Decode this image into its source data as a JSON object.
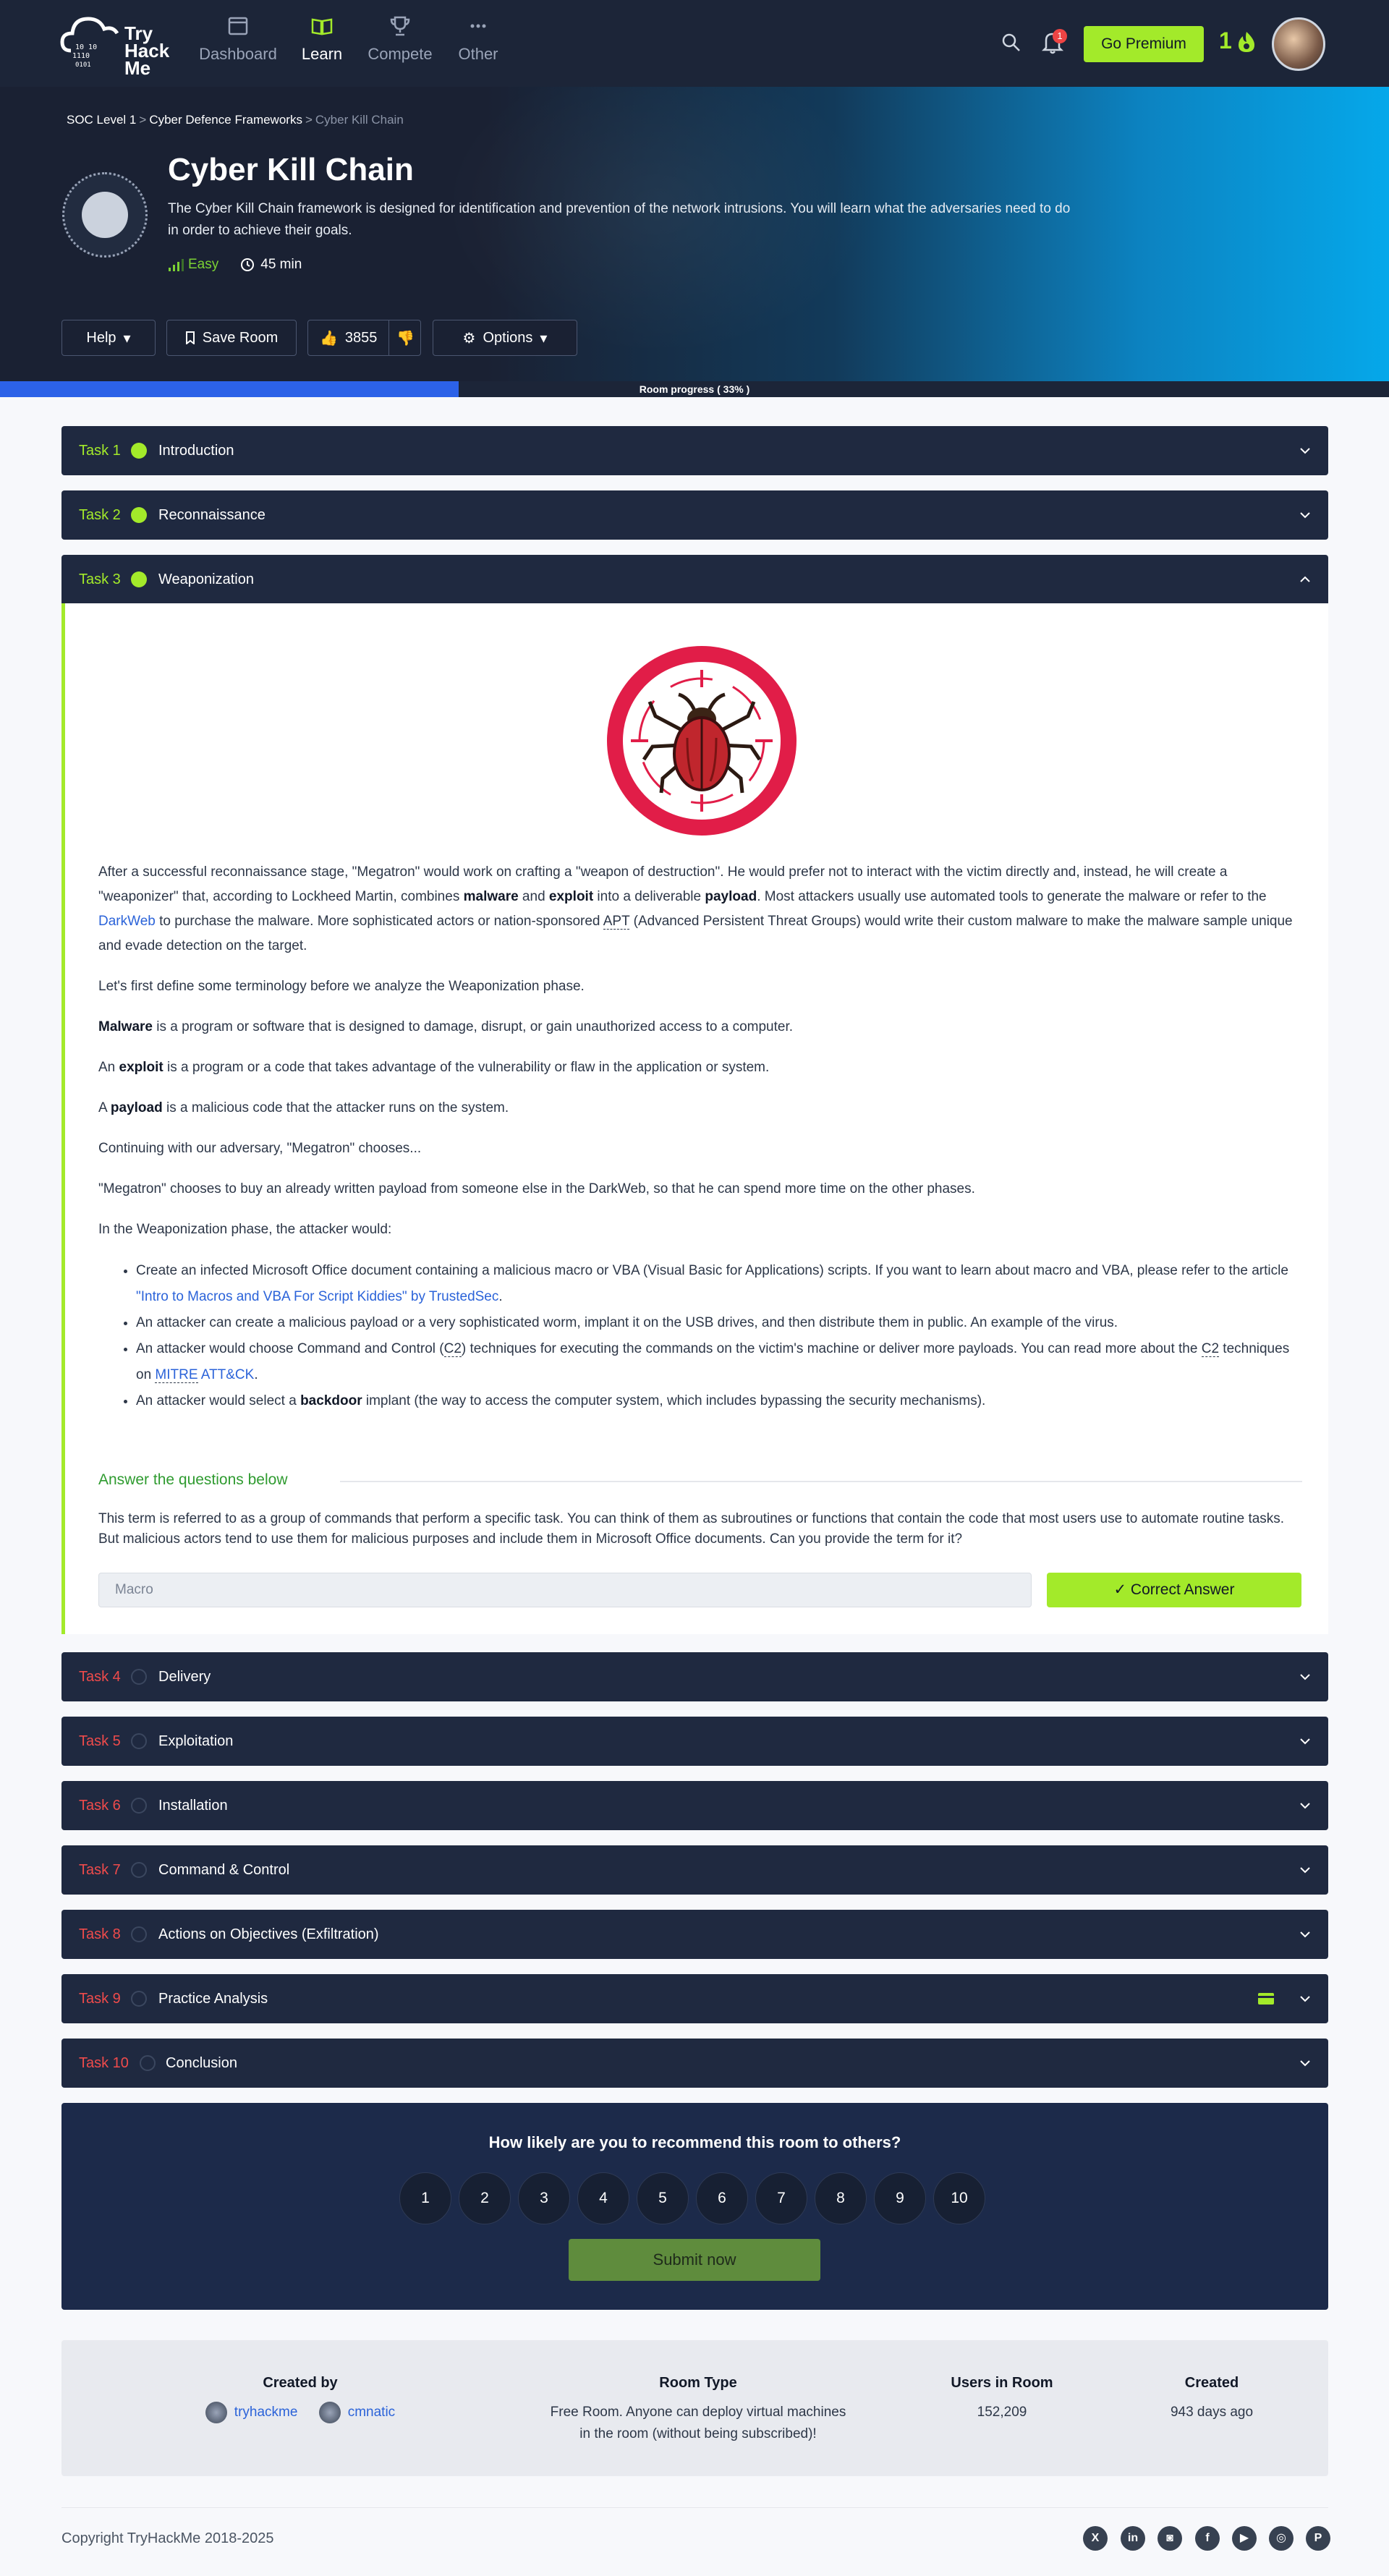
{
  "nav": {
    "logo_lines": [
      "Try",
      "Hack",
      "Me"
    ],
    "items": [
      {
        "label": "Dashboard",
        "icon": "dashboard-icon"
      },
      {
        "label": "Learn",
        "icon": "book-icon",
        "active": true
      },
      {
        "label": "Compete",
        "icon": "trophy-icon"
      },
      {
        "label": "Other",
        "icon": "more-icon"
      }
    ],
    "notification_count": "1",
    "premium_label": "Go Premium",
    "streak": "1"
  },
  "breadcrumb": [
    "SOC Level 1",
    "Cyber Defence Frameworks",
    "Cyber Kill Chain"
  ],
  "room": {
    "title": "Cyber Kill Chain",
    "description": "The Cyber Kill Chain framework is designed for identification and prevention of the network intrusions. You will learn what the adversaries need to do in order to achieve their goals.",
    "difficulty": "Easy",
    "duration": "45 min",
    "buttons": {
      "help": "Help",
      "save": "Save Room",
      "likes": "3855",
      "options": "Options"
    }
  },
  "progress": {
    "label": "Room progress ( 33% )",
    "percent": 33
  },
  "tasks": [
    {
      "num": "Task 1",
      "title": "Introduction",
      "done": true
    },
    {
      "num": "Task 2",
      "title": "Reconnaissance",
      "done": true
    },
    {
      "num": "Task 3",
      "title": "Weaponization",
      "done": true
    },
    {
      "num": "Task 4",
      "title": "Delivery",
      "done": false
    },
    {
      "num": "Task 5",
      "title": "Exploitation",
      "done": false
    },
    {
      "num": "Task 6",
      "title": "Installation",
      "done": false
    },
    {
      "num": "Task 7",
      "title": "Command & Control",
      "done": false
    },
    {
      "num": "Task 8",
      "title": "Actions on Objectives (Exfiltration)",
      "done": false
    },
    {
      "num": "Task 9",
      "title": "Practice Analysis",
      "done": false
    },
    {
      "num": "Task 10",
      "title": "Conclusion",
      "done": false
    }
  ],
  "task3": {
    "p1a": "After a successful reconnaissance stage, \"Megatron\" would work on crafting a \"weapon of destruction\". He would prefer not to interact with the victim directly and, instead, he will create a \"weaponizer\" that, according to Lockheed Martin, combines ",
    "p1_malware": "malware",
    "p1b": " and ",
    "p1_exploit": "exploit",
    "p1c": " into a deliverable ",
    "p1_payload": "payload",
    "p1d": ". Most attackers usually use automated tools to generate the malware or refer to the ",
    "p1_darkweb": "DarkWeb",
    "p1e": " to purchase the malware. More sophisticated actors or nation-sponsored ",
    "p1_apt": "APT",
    "p1f": " (Advanced Persistent Threat Groups) would write their custom malware to make the malware sample unique and evade detection on the target.",
    "p2": "Let's first define some terminology before we analyze the Weaponization phase.",
    "p3_term": "Malware",
    "p3": " is a program or software that is designed to damage, disrupt, or gain unauthorized access to a computer.",
    "p4_pre": "An ",
    "p4_term": "exploit",
    "p4": " is a program or a code that takes advantage of the vulnerability or flaw in the application or system.",
    "p5_pre": "A ",
    "p5_term": "payload",
    "p5": " is a malicious code that the attacker runs on the system.",
    "p6": "Continuing with our adversary, \"Megatron\" chooses...",
    "p7": "\"Megatron\" chooses to buy an already written payload from someone else in the DarkWeb, so that he can spend more time on the other phases.",
    "p8": "In the Weaponization phase, the attacker would:",
    "li1a": "Create an infected Microsoft Office document containing a malicious macro or VBA (Visual Basic for Applications) scripts. If you want to learn about macro and VBA, please refer to the article ",
    "li1_link": "\"Intro to Macros and VBA For Script Kiddies\" by TrustedSec",
    "li1b": ".",
    "li2": "An attacker can create a malicious payload or a very sophisticated worm, implant it on the USB drives, and then distribute them in public. An example of the virus.",
    "li3a": "An attacker would choose Command and Control (",
    "li3_c2": "C2",
    "li3b": ") techniques for executing the commands on the victim's machine or deliver more payloads. You can read more about the ",
    "li3_c2b": "C2",
    "li3c": " techniques on ",
    "li3_mitre": "MITRE",
    "li3_attck": " ATT&CK",
    "li3d": ".",
    "li4a": "An attacker would select a ",
    "li4_term": "backdoor",
    "li4b": " implant (the way to access the computer system, which includes bypassing the security mechanisms).",
    "answer_heading": "Answer the questions below",
    "question": "This term is referred to as a group of commands that perform a specific task. You can think of them as subroutines or functions that contain the code that most users use to automate routine tasks. But malicious actors tend to use them for malicious purposes and include them in Microsoft Office documents. Can you provide the term for it?",
    "answer": "Macro",
    "correct_label": "✓ Correct Answer"
  },
  "rating": {
    "question": "How likely are you to recommend this room to others?",
    "options": [
      "1",
      "2",
      "3",
      "4",
      "5",
      "6",
      "7",
      "8",
      "9",
      "10"
    ],
    "submit": "Submit now"
  },
  "info": {
    "created_by_label": "Created by",
    "creators": [
      "tryhackme",
      "cmnatic"
    ],
    "room_type_label": "Room Type",
    "room_type": [
      "Free Room. Anyone can deploy virtual machines",
      "in the room (without being subscribed)!"
    ],
    "users_label": "Users in Room",
    "users": "152,209",
    "created_label": "Created",
    "created": "943 days ago"
  },
  "footer": {
    "copyright": "Copyright TryHackMe 2018-2025",
    "social": [
      "x-icon",
      "linkedin-icon",
      "discord-icon",
      "facebook-icon",
      "youtube-icon",
      "instagram-icon",
      "pinterest-icon"
    ]
  },
  "colors": {
    "accent": "#a3ea2a",
    "navy": "#1c2538",
    "danger": "#ef4b4b",
    "link": "#2b63d9"
  }
}
